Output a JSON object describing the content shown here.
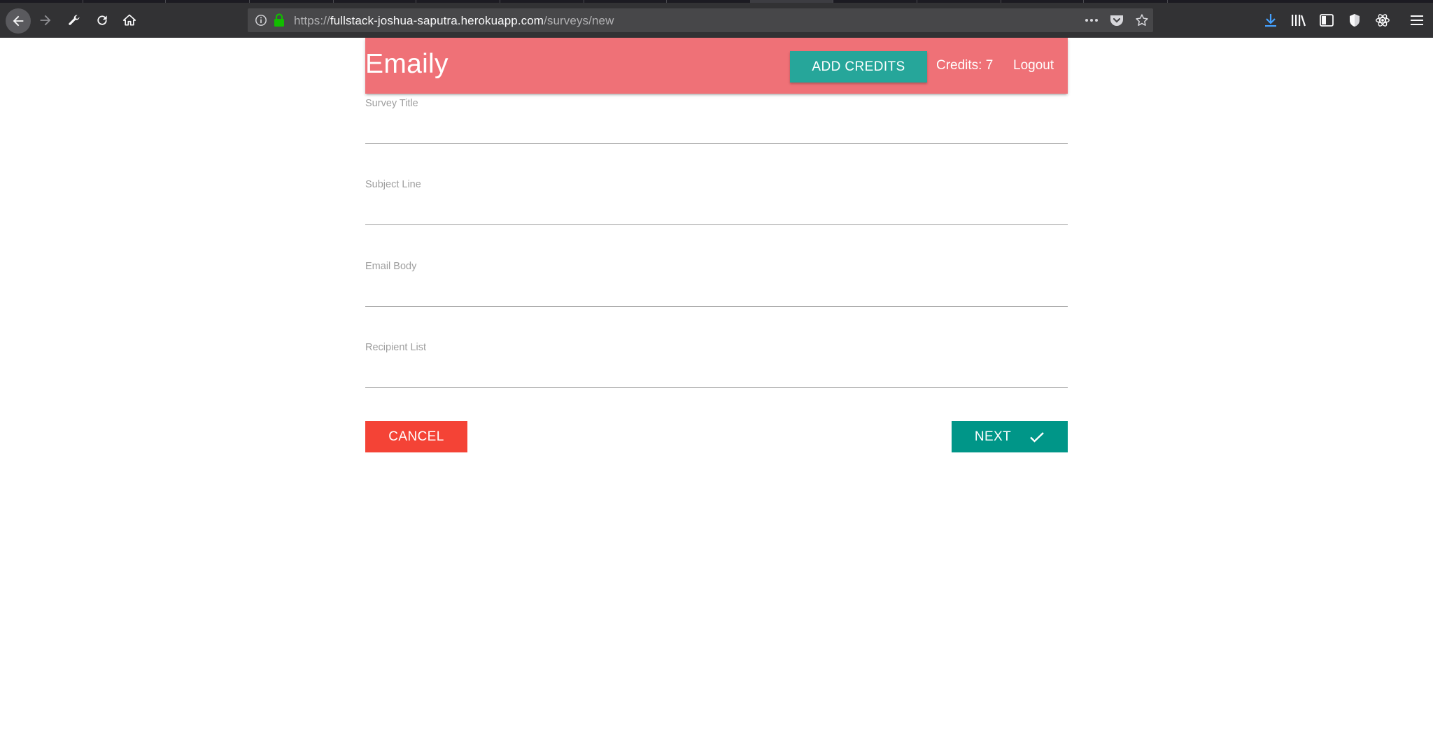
{
  "browser": {
    "url_scheme": "https://",
    "url_host": "fullstack-joshua-saputra.herokuapp.com",
    "url_path": "/surveys/new",
    "download_icon_color": "#45a1ff",
    "lock_color": "#12bc00"
  },
  "header": {
    "brand": "Emaily",
    "add_credits_label": "ADD CREDITS",
    "credits_text": "Credits: 7",
    "logout_label": "Logout",
    "bg_color": "#ef7177",
    "accent_color": "#26a69a"
  },
  "form": {
    "fields": [
      {
        "label": "Survey Title",
        "value": ""
      },
      {
        "label": "Subject Line",
        "value": ""
      },
      {
        "label": "Email Body",
        "value": ""
      },
      {
        "label": "Recipient List",
        "value": ""
      }
    ],
    "cancel_label": "CANCEL",
    "next_label": "NEXT",
    "next_icon": "check-icon",
    "cancel_color": "#f44336",
    "next_color": "#009688"
  }
}
